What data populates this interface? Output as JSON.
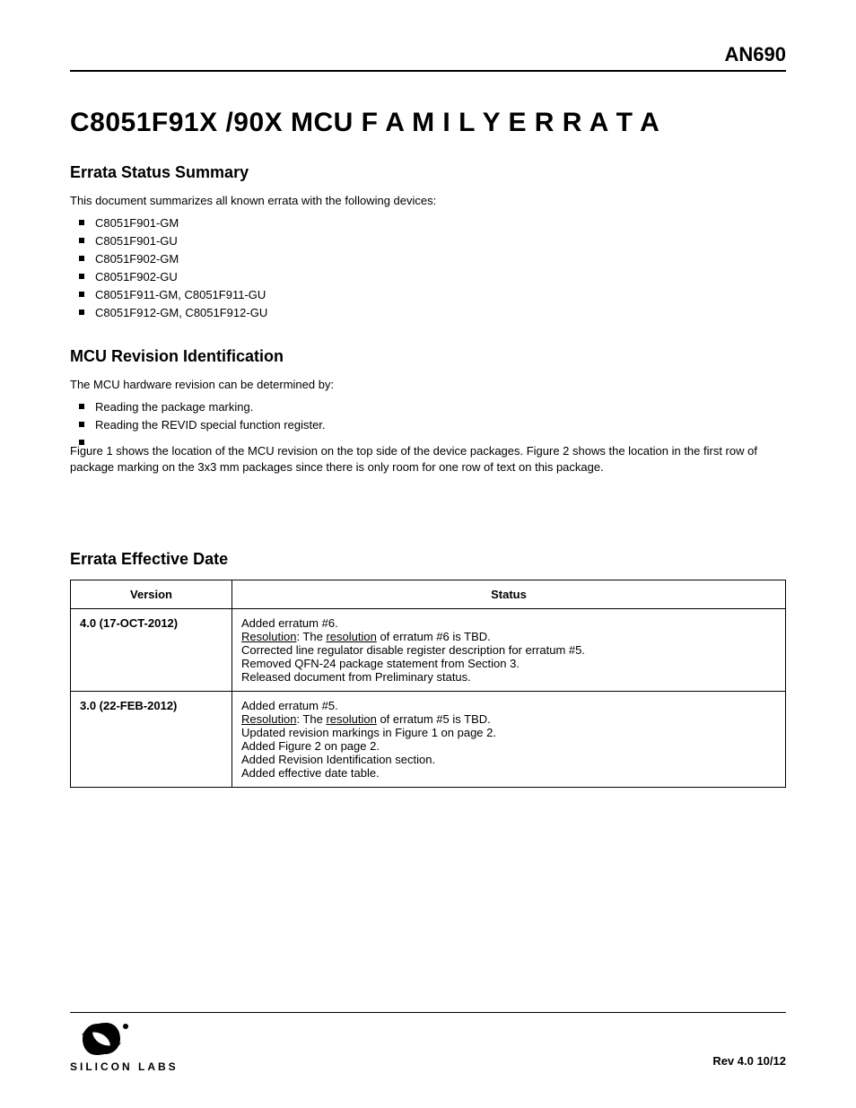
{
  "header_right": "AN690",
  "title": "C8051F91X /90X MCU F A M I L Y E R R A T A",
  "status": {
    "heading": "Errata Status Summary",
    "intro": "This document summarizes all known errata with the following devices:",
    "devices": [
      "C8051F901-GM",
      "C8051F901-GU",
      "C8051F902-GM",
      "C8051F902-GU",
      "C8051F911-GM",
      "C8051F911-GU",
      "C8051F912-GM",
      "C8051F912-GU"
    ],
    "devices_per_line": 2
  },
  "revision": {
    "heading": "MCU Revision Identification",
    "intro": "The MCU hardware revision can be determined by:",
    "methods": [
      "Reading the package marking.",
      "Reading the REVID special function register."
    ],
    "methods_per_line": 2,
    "para": "Figure 1 shows the location of the MCU revision on the top side of the device packages. Figure 2 shows the location in the first row of package marking on the 3x3 mm packages since there is only room for one row of text on this package."
  },
  "table_heading": "Errata Effective Date",
  "table": {
    "headers": [
      "Version",
      "Status"
    ],
    "rows": [
      {
        "version": "4.0 (17-OCT-2012)",
        "status_lines": [
          "Added erratum #6.",
          "<u>Resolution</u>: The <u>resolution</u> of erratum #6 is TBD.",
          "Corrected line regulator disable register description for erratum #5.",
          "Removed QFN-24 package statement from Section 3.",
          "Released document from Preliminary status."
        ]
      },
      {
        "version": "3.0 (22-FEB-2012)",
        "status_lines": [
          "Added erratum #5.",
          "<u>Resolution</u>: The <u>resolution</u> of erratum #5 is TBD.",
          "Updated revision markings in Figure 1 on page 2.",
          "Added Figure 2 on page 2.",
          "Added Revision Identification section.",
          "Added effective date table."
        ]
      }
    ]
  },
  "footer": {
    "logo_text": "SILICON LABS",
    "right": "Rev 4.0 10/12"
  }
}
